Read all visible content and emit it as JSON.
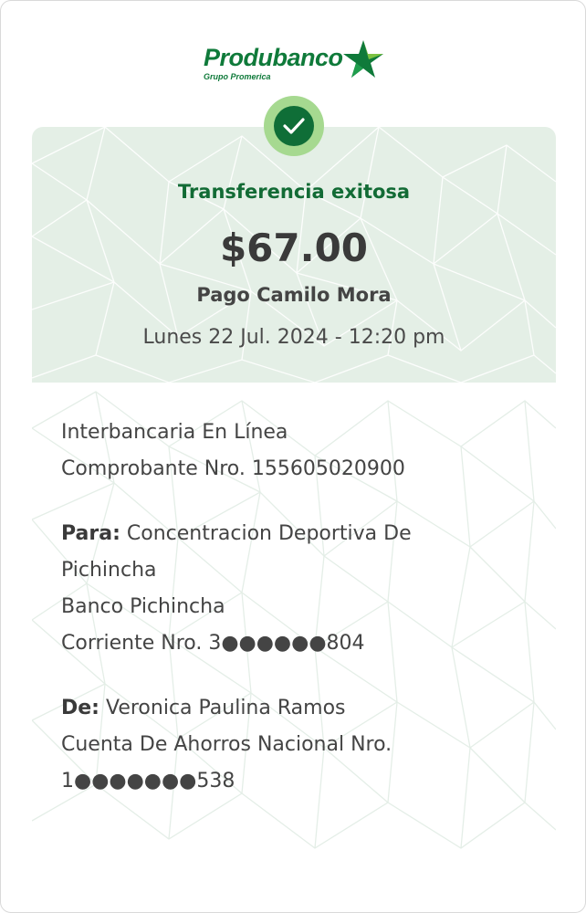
{
  "brand": {
    "name": "Produbanco",
    "subtitle": "Grupo Promerica",
    "color": "#0f7a3a"
  },
  "status": {
    "icon": "check-circle-icon",
    "title": "Transferencia exitosa"
  },
  "transaction": {
    "amount": "$67.00",
    "description": "Pago Camilo Mora",
    "datetime": "Lunes 22 Jul. 2024 - 12:20 pm",
    "type": "Interbancaria En Línea",
    "receipt": "Comprobante Nro. 155605020900"
  },
  "to": {
    "label": "Para:",
    "name_line1": "Concentracion Deportiva De",
    "name_line2": "Pichincha",
    "bank": "Banco Pichincha",
    "account": "Corriente Nro. 3●●●●●●804"
  },
  "from": {
    "label": "De:",
    "name": "Veronica Paulina Ramos",
    "account_line1": "Cuenta De Ahorros Nacional Nro.",
    "account_line2": "1●●●●●●●538"
  }
}
